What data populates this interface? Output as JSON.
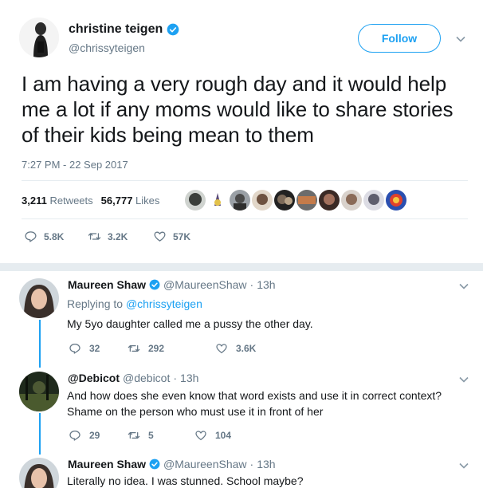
{
  "tweet": {
    "author_name": "christine teigen",
    "author_handle": "@chrissyteigen",
    "follow_label": "Follow",
    "text": "I am having a very rough day and it would help me a lot if any moms would like to share stories of their kids being mean to them",
    "timestamp": "7:27 PM - 22 Sep 2017",
    "retweets_count": "3,211",
    "retweets_label": "Retweets",
    "likes_count": "56,777",
    "likes_label": "Likes",
    "reply_count": "5.8K",
    "retweet_action_count": "3.2K",
    "like_action_count": "57K"
  },
  "replies": [
    {
      "author_name": "Maureen Shaw",
      "author_handle": "@MaureenShaw",
      "time": "13h",
      "replying_prefix": "Replying to",
      "replying_to": "@chrissyteigen",
      "text": "My 5yo daughter called me a pussy the other day.",
      "reply_count": "32",
      "retweet_count": "292",
      "like_count": "3.6K"
    },
    {
      "author_name": "@Debicot",
      "author_handle": "@debicot",
      "time": "13h",
      "text": "And how does she even know that word exists and use it in correct context? Shame on the person who must use it in front of her",
      "reply_count": "29",
      "retweet_count": "5",
      "like_count": "104"
    },
    {
      "author_name": "Maureen Shaw",
      "author_handle": "@MaureenShaw",
      "time": "13h",
      "text": "Literally no idea. I was stunned. School maybe?"
    }
  ],
  "separator": "·",
  "colors": {
    "accent": "#1da1f2",
    "text": "#14171a",
    "muted": "#657786",
    "divider": "#e6ecf0"
  }
}
